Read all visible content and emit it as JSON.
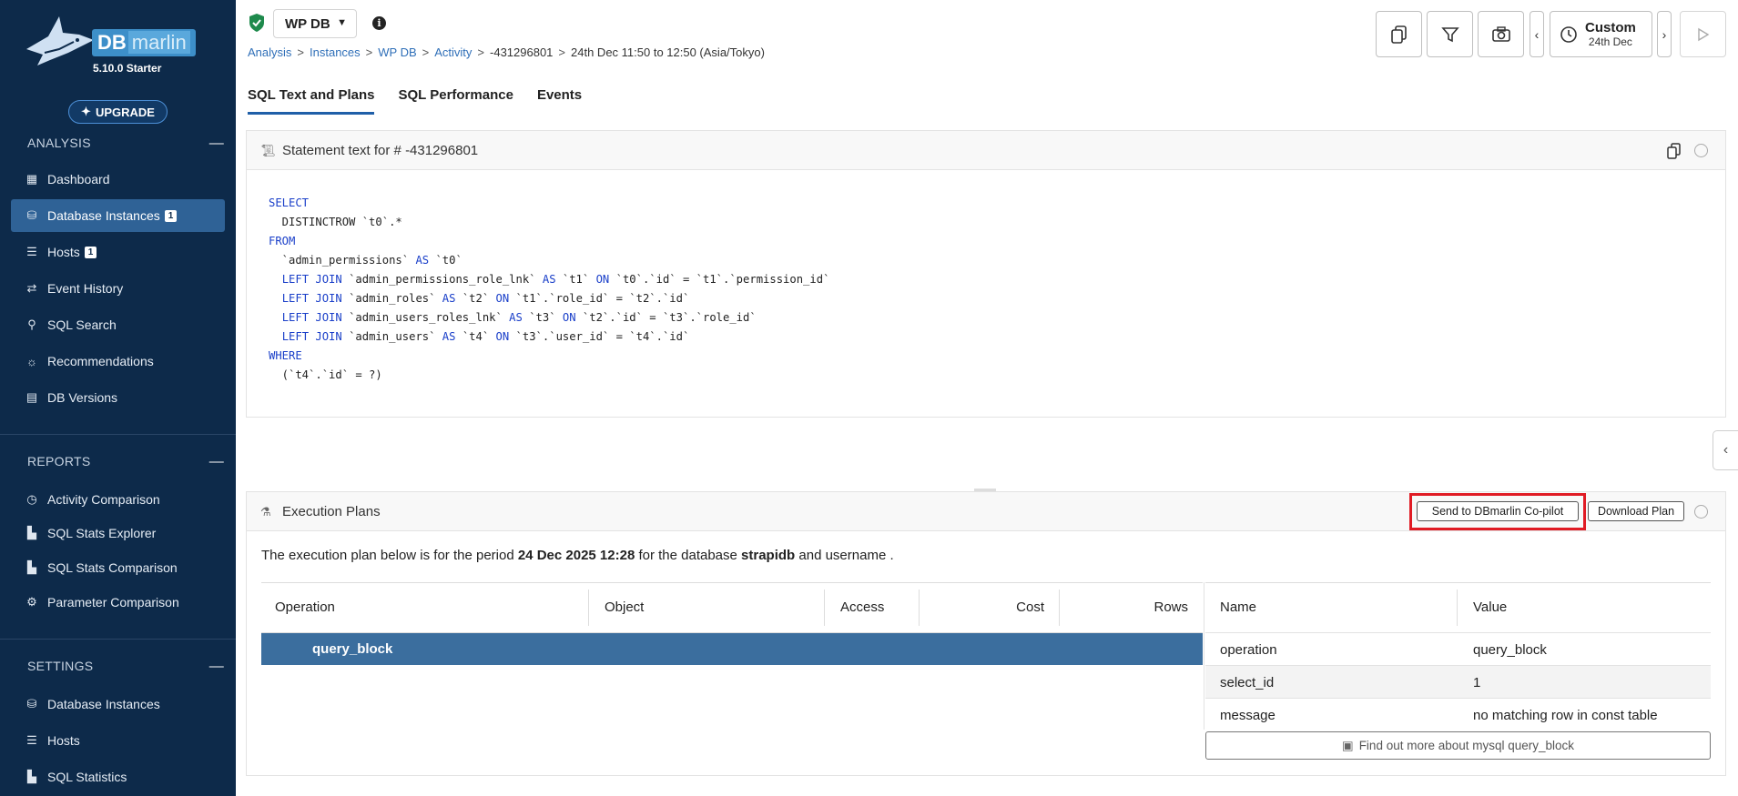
{
  "app": {
    "brand_db": "DB",
    "brand_marlin": "marlin",
    "version": "5.10.0 Starter",
    "upgrade_label": "UPGRADE"
  },
  "sidebar": {
    "analysis_title": "ANALYSIS",
    "analysis_items": [
      {
        "label": "Dashboard",
        "icon": "grid-icon"
      },
      {
        "label": "Database Instances",
        "icon": "database-icon",
        "count": "1",
        "active": true
      },
      {
        "label": "Hosts",
        "icon": "server-icon",
        "count": "1"
      },
      {
        "label": "Event History",
        "icon": "arrows-icon"
      },
      {
        "label": "SQL Search",
        "icon": "search-icon"
      },
      {
        "label": "Recommendations",
        "icon": "lightbulb-icon"
      },
      {
        "label": "DB Versions",
        "icon": "document-icon"
      }
    ],
    "reports_title": "REPORTS",
    "reports_items": [
      {
        "label": "Activity Comparison",
        "icon": "stopwatch-icon"
      },
      {
        "label": "SQL Stats Explorer",
        "icon": "chart-icon"
      },
      {
        "label": "SQL Stats Comparison",
        "icon": "chart-icon"
      },
      {
        "label": "Parameter Comparison",
        "icon": "gear-icon"
      }
    ],
    "settings_title": "SETTINGS",
    "settings_items": [
      {
        "label": "Database Instances",
        "icon": "database-icon"
      },
      {
        "label": "Hosts",
        "icon": "server-icon"
      },
      {
        "label": "SQL Statistics",
        "icon": "chart-icon"
      }
    ]
  },
  "header": {
    "db_name": "WP DB",
    "breadcrumb": [
      "Analysis",
      "Instances",
      "WP DB",
      "Activity"
    ],
    "statement_id": "-431296801",
    "period": "24th Dec 11:50 to 12:50 (Asia/Tokyo)",
    "custom_label": "Custom",
    "custom_date": "24th Dec"
  },
  "tabs": [
    "SQL Text and Plans",
    "SQL Performance",
    "Events"
  ],
  "statement": {
    "title": "Statement text for # -431296801",
    "lines": [
      [
        {
          "kw": true,
          "t": "SELECT"
        }
      ],
      [
        {
          "t": "  DISTINCTROW `t0`.*"
        }
      ],
      [
        {
          "kw": true,
          "t": "FROM"
        }
      ],
      [
        {
          "t": "  `admin_permissions` "
        },
        {
          "kw": true,
          "t": "AS"
        },
        {
          "t": " `t0`"
        }
      ],
      [
        {
          "t": "  "
        },
        {
          "kw": true,
          "t": "LEFT JOIN"
        },
        {
          "t": " `admin_permissions_role_lnk` "
        },
        {
          "kw": true,
          "t": "AS"
        },
        {
          "t": " `t1` "
        },
        {
          "kw": true,
          "t": "ON"
        },
        {
          "t": " `t0`.`id` = `t1`.`permission_id`"
        }
      ],
      [
        {
          "t": "  "
        },
        {
          "kw": true,
          "t": "LEFT JOIN"
        },
        {
          "t": " `admin_roles` "
        },
        {
          "kw": true,
          "t": "AS"
        },
        {
          "t": " `t2` "
        },
        {
          "kw": true,
          "t": "ON"
        },
        {
          "t": " `t1`.`role_id` = `t2`.`id`"
        }
      ],
      [
        {
          "t": "  "
        },
        {
          "kw": true,
          "t": "LEFT JOIN"
        },
        {
          "t": " `admin_users_roles_lnk` "
        },
        {
          "kw": true,
          "t": "AS"
        },
        {
          "t": " `t3` "
        },
        {
          "kw": true,
          "t": "ON"
        },
        {
          "t": " `t2`.`id` = `t3`.`role_id`"
        }
      ],
      [
        {
          "t": "  "
        },
        {
          "kw": true,
          "t": "LEFT JOIN"
        },
        {
          "t": " `admin_users` "
        },
        {
          "kw": true,
          "t": "AS"
        },
        {
          "t": " `t4` "
        },
        {
          "kw": true,
          "t": "ON"
        },
        {
          "t": " `t3`.`user_id` = `t4`.`id`"
        }
      ],
      [
        {
          "kw": true,
          "t": "WHERE"
        }
      ],
      [
        {
          "t": "  (`t4`.`id` = ?)"
        }
      ]
    ]
  },
  "plans": {
    "title": "Execution Plans",
    "send_label": "Send to DBmarlin Co-pilot",
    "download_label": "Download Plan",
    "desc_prefix": "The execution plan below is for the period ",
    "desc_period": "24 Dec 2025 12:28",
    "desc_mid": " for the database ",
    "desc_db": "strapidb",
    "desc_suffix": " and username .",
    "columns": [
      "Operation",
      "Object",
      "Access",
      "Cost",
      "Rows"
    ],
    "selected_row": "query_block",
    "detail_columns": [
      "Name",
      "Value"
    ],
    "detail_rows": [
      {
        "name": "operation",
        "value": "query_block"
      },
      {
        "name": "select_id",
        "value": "1"
      },
      {
        "name": "message",
        "value": "no matching row in const table"
      }
    ],
    "find_more_label": "Find out more about mysql query_block"
  }
}
